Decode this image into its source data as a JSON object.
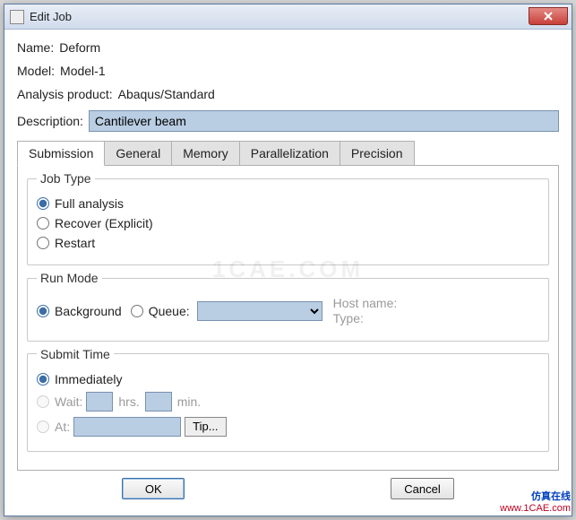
{
  "window": {
    "title": "Edit Job",
    "close_label": "Close"
  },
  "fields": {
    "name_label": "Name:",
    "name_value": "Deform",
    "model_label": "Model:",
    "model_value": "Model-1",
    "product_label": "Analysis product:",
    "product_value": "Abaqus/Standard",
    "description_label": "Description:",
    "description_value": "Cantilever beam"
  },
  "tabs": {
    "submission": "Submission",
    "general": "General",
    "memory": "Memory",
    "parallelization": "Parallelization",
    "precision": "Precision"
  },
  "job_type": {
    "legend": "Job Type",
    "full": "Full analysis",
    "recover": "Recover (Explicit)",
    "restart": "Restart"
  },
  "run_mode": {
    "legend": "Run Mode",
    "background": "Background",
    "queue": "Queue:",
    "host_label": "Host name:",
    "type_label": "Type:"
  },
  "submit_time": {
    "legend": "Submit Time",
    "immediately": "Immediately",
    "wait": "Wait:",
    "hrs": "hrs.",
    "min": "min.",
    "at": "At:",
    "tip": "Tip..."
  },
  "buttons": {
    "ok": "OK",
    "cancel": "Cancel"
  },
  "branding": {
    "line1": "仿真在线",
    "line2": "www.1CAE.com",
    "watermark": "1CAE.COM"
  }
}
